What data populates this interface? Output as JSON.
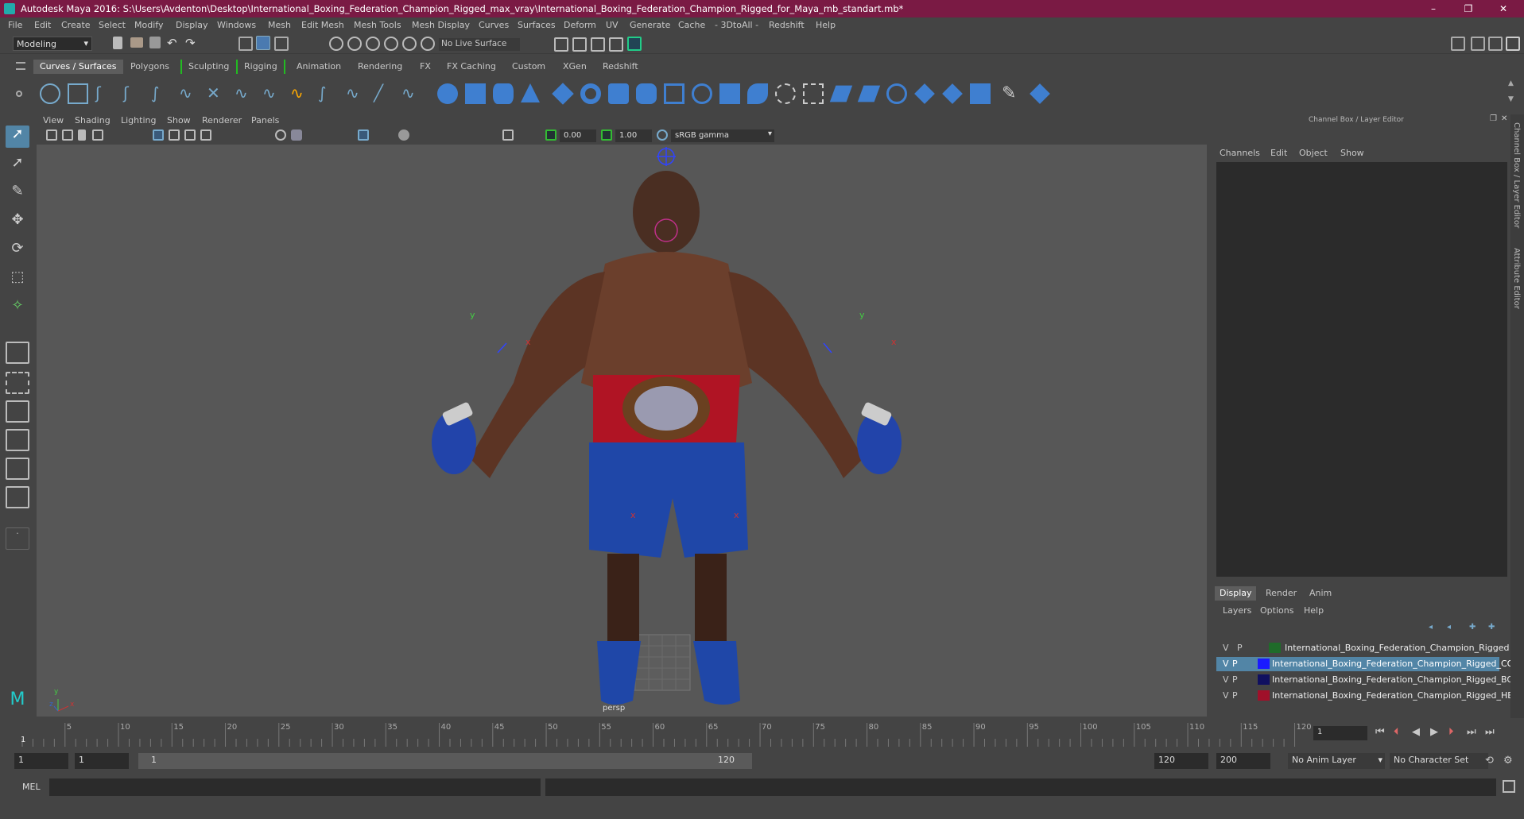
{
  "window": {
    "title": "Autodesk Maya 2016: S:\\Users\\Avdenton\\Desktop\\International_Boxing_Federation_Champion_Rigged_max_vray\\International_Boxing_Federation_Champion_Rigged_for_Maya_mb_standart.mb*",
    "controls": [
      "–",
      "❐",
      "✕"
    ]
  },
  "menubar": [
    "File",
    "Edit",
    "Create",
    "Select",
    "Modify",
    "Display",
    "Windows",
    "Mesh",
    "Edit Mesh",
    "Mesh Tools",
    "Mesh Display",
    "Curves",
    "Surfaces",
    "Deform",
    "UV",
    "Generate",
    "Cache",
    "- 3DtoAll -",
    "Redshift",
    "Help"
  ],
  "statusline": {
    "mode": "Modeling",
    "live_surface": "No Live Surface"
  },
  "shelf_tabs": [
    "Curves / Surfaces",
    "Polygons",
    "Sculpting",
    "Rigging",
    "Animation",
    "Rendering",
    "FX",
    "FX Caching",
    "Custom",
    "XGen",
    "Redshift"
  ],
  "shelf_active": "Curves / Surfaces",
  "viewport": {
    "menus": [
      "View",
      "Shading",
      "Lighting",
      "Show",
      "Renderer",
      "Panels"
    ],
    "exposure": "0.00",
    "gamma": "1.00",
    "colorspace": "sRGB gamma",
    "camera_label": "persp",
    "axis_labels": {
      "y": "y",
      "x": "x",
      "z": "z"
    }
  },
  "channel_box": {
    "title": "Channel Box / Layer Editor",
    "menus": [
      "Channels",
      "Edit",
      "Object",
      "Show"
    ],
    "side_tabs": [
      "Channel Box / Layer Editor",
      "Attribute Editor"
    ]
  },
  "layer_editor": {
    "tabs": [
      "Display",
      "Render",
      "Anim"
    ],
    "active_tab": "Display",
    "menus": [
      "Layers",
      "Options",
      "Help"
    ],
    "layers": [
      {
        "v": "V",
        "p": "P",
        "color": "#1f6b2a",
        "name": "International_Boxing_Federation_Champion_Rigged",
        "selected": false
      },
      {
        "v": "V",
        "p": "P",
        "color": "#1a1aff",
        "name": "International_Boxing_Federation_Champion_Rigged_CO",
        "selected": true
      },
      {
        "v": "V",
        "p": "P",
        "color": "#101060",
        "name": "International_Boxing_Federation_Champion_Rigged_BO",
        "selected": false
      },
      {
        "v": "V",
        "p": "P",
        "color": "#a0102a",
        "name": "International_Boxing_Federation_Champion_Rigged_HEI",
        "selected": false
      }
    ]
  },
  "timeline": {
    "ticks": [
      "5",
      "10",
      "15",
      "20",
      "25",
      "30",
      "35",
      "40",
      "45",
      "50",
      "55",
      "60",
      "65",
      "70",
      "75",
      "80",
      "85",
      "90",
      "95",
      "100",
      "105",
      "110",
      "115",
      "120"
    ],
    "current_marker": "1",
    "current_frame": "1"
  },
  "range": {
    "start": "1",
    "playback_start": "1",
    "slider_start": "1",
    "slider_end": "120",
    "playback_end": "120",
    "end": "200",
    "anim_layer": "No Anim Layer",
    "character_set": "No Character Set"
  },
  "command": {
    "label": "MEL"
  }
}
